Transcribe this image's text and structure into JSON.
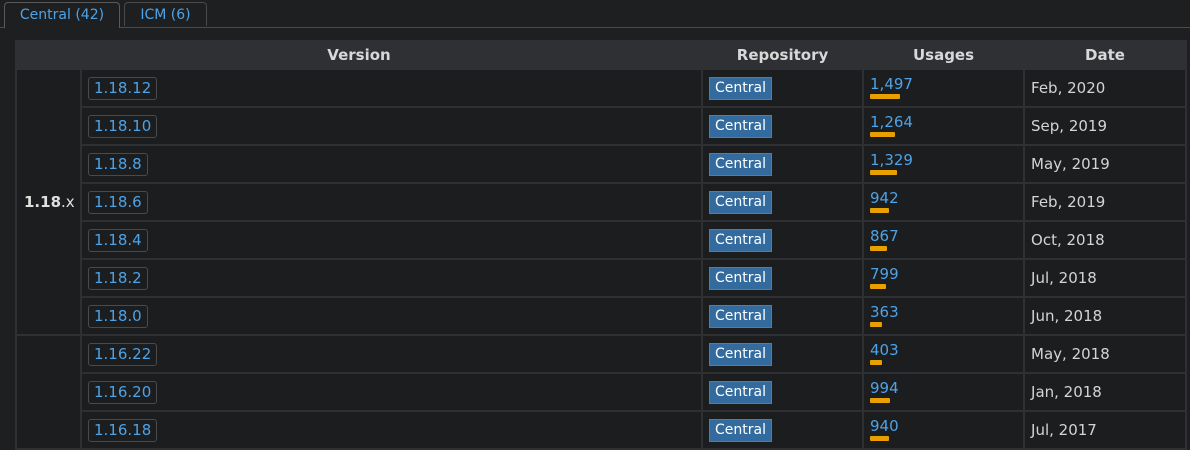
{
  "tabs": [
    {
      "label": "Central (42)",
      "active": true
    },
    {
      "label": "ICM (6)",
      "active": false
    }
  ],
  "table": {
    "headers": {
      "version": "Version",
      "repository": "Repository",
      "usages": "Usages",
      "date": "Date"
    },
    "groups": [
      {
        "major": "1.18",
        "suffix": ".x"
      },
      {
        "major": "",
        "suffix": ""
      }
    ],
    "rows": [
      {
        "group": 0,
        "version": "1.18.12",
        "repo": "Central",
        "usages": "1,497",
        "usage_value": 1497,
        "date": "Feb, 2020"
      },
      {
        "group": 0,
        "version": "1.18.10",
        "repo": "Central",
        "usages": "1,264",
        "usage_value": 1264,
        "date": "Sep, 2019"
      },
      {
        "group": 0,
        "version": "1.18.8",
        "repo": "Central",
        "usages": "1,329",
        "usage_value": 1329,
        "date": "May, 2019"
      },
      {
        "group": 0,
        "version": "1.18.6",
        "repo": "Central",
        "usages": "942",
        "usage_value": 942,
        "date": "Feb, 2019"
      },
      {
        "group": 0,
        "version": "1.18.4",
        "repo": "Central",
        "usages": "867",
        "usage_value": 867,
        "date": "Oct, 2018"
      },
      {
        "group": 0,
        "version": "1.18.2",
        "repo": "Central",
        "usages": "799",
        "usage_value": 799,
        "date": "Jul, 2018"
      },
      {
        "group": 0,
        "version": "1.18.0",
        "repo": "Central",
        "usages": "363",
        "usage_value": 363,
        "date": "Jun, 2018"
      },
      {
        "group": 1,
        "version": "1.16.22",
        "repo": "Central",
        "usages": "403",
        "usage_value": 403,
        "date": "May, 2018"
      },
      {
        "group": 1,
        "version": "1.16.20",
        "repo": "Central",
        "usages": "994",
        "usage_value": 994,
        "date": "Jan, 2018"
      },
      {
        "group": 1,
        "version": "1.16.18",
        "repo": "Central",
        "usages": "940",
        "usage_value": 940,
        "date": "Jul, 2017"
      }
    ]
  },
  "colors": {
    "link": "#4da3e8",
    "bar": "#e8a000",
    "repo_badge": "#336b9e"
  }
}
